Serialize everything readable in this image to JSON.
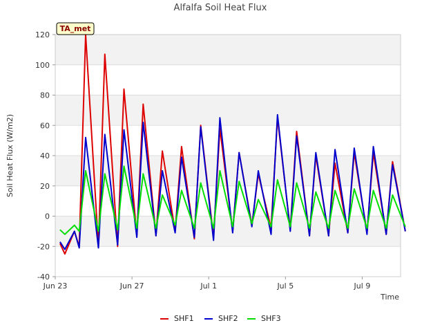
{
  "chart_data": {
    "type": "line",
    "title": "Alfalfa Soil Heat Flux",
    "xlabel": "Time",
    "ylabel": "Soil Heat Flux (W/m2)",
    "badge": "TA_met",
    "ylim": [
      -40,
      120
    ],
    "yticks": [
      -40,
      -20,
      0,
      20,
      40,
      60,
      80,
      100,
      120
    ],
    "xlim": [
      "2023-06-23",
      "2023-07-11"
    ],
    "xticks": [
      {
        "date": "2023-06-23",
        "label": "Jun 23"
      },
      {
        "date": "2023-06-27",
        "label": "Jun 27"
      },
      {
        "date": "2023-07-01",
        "label": "Jul 1"
      },
      {
        "date": "2023-07-05",
        "label": "Jul 5"
      },
      {
        "date": "2023-07-09",
        "label": "Jul 9"
      }
    ],
    "grid": "horizontal bands",
    "legend_position": "bottom-center",
    "series": [
      {
        "name": "SHF1",
        "color": "#dd0000",
        "x": [
          "2023-06-23T06:00",
          "2023-06-23T12:00",
          "2023-06-24T00:00",
          "2023-06-24T06:00",
          "2023-06-24T14:00",
          "2023-06-25T06:00",
          "2023-06-25T14:00",
          "2023-06-26T06:00",
          "2023-06-26T14:00",
          "2023-06-27T06:00",
          "2023-06-27T14:00",
          "2023-06-28T06:00",
          "2023-06-28T14:00",
          "2023-06-29T06:00",
          "2023-06-29T14:00",
          "2023-06-30T06:00",
          "2023-06-30T14:00",
          "2023-07-01T06:00",
          "2023-07-01T14:00",
          "2023-07-02T06:00",
          "2023-07-02T14:00",
          "2023-07-03T06:00",
          "2023-07-03T14:00",
          "2023-07-04T06:00",
          "2023-07-04T14:00",
          "2023-07-05T06:00",
          "2023-07-05T14:00",
          "2023-07-06T06:00",
          "2023-07-06T14:00",
          "2023-07-07T06:00",
          "2023-07-07T14:00",
          "2023-07-08T06:00",
          "2023-07-08T14:00",
          "2023-07-09T06:00",
          "2023-07-09T14:00",
          "2023-07-10T06:00",
          "2023-07-10T14:00",
          "2023-07-11T06:00"
        ],
        "y": [
          -18,
          -25,
          -10,
          -20,
          120,
          -20,
          107,
          -20,
          84,
          -13,
          74,
          -13,
          43,
          -10,
          46,
          -15,
          60,
          -14,
          58,
          -10,
          42,
          -6,
          28,
          -8,
          65,
          -9,
          56,
          -13,
          40,
          -13,
          35,
          -11,
          42,
          -11,
          42,
          -12,
          36,
          -10
        ]
      },
      {
        "name": "SHF2",
        "color": "#0000cc",
        "x": [
          "2023-06-23T06:00",
          "2023-06-23T12:00",
          "2023-06-24T00:00",
          "2023-06-24T06:00",
          "2023-06-24T14:00",
          "2023-06-25T06:00",
          "2023-06-25T14:00",
          "2023-06-26T06:00",
          "2023-06-26T14:00",
          "2023-06-27T06:00",
          "2023-06-27T14:00",
          "2023-06-28T06:00",
          "2023-06-28T14:00",
          "2023-06-29T06:00",
          "2023-06-29T14:00",
          "2023-06-30T06:00",
          "2023-06-30T14:00",
          "2023-07-01T06:00",
          "2023-07-01T14:00",
          "2023-07-02T06:00",
          "2023-07-02T14:00",
          "2023-07-03T06:00",
          "2023-07-03T14:00",
          "2023-07-04T06:00",
          "2023-07-04T14:00",
          "2023-07-05T06:00",
          "2023-07-05T14:00",
          "2023-07-06T06:00",
          "2023-07-06T14:00",
          "2023-07-07T06:00",
          "2023-07-07T14:00",
          "2023-07-08T06:00",
          "2023-07-08T14:00",
          "2023-07-09T06:00",
          "2023-07-09T14:00",
          "2023-07-10T06:00",
          "2023-07-10T14:00",
          "2023-07-11T06:00"
        ],
        "y": [
          -17,
          -22,
          -10,
          -21,
          52,
          -21,
          54,
          -19,
          57,
          -14,
          62,
          -13,
          30,
          -11,
          39,
          -14,
          59,
          -16,
          65,
          -11,
          42,
          -7,
          30,
          -12,
          67,
          -10,
          53,
          -13,
          42,
          -13,
          44,
          -11,
          45,
          -12,
          46,
          -12,
          34,
          -10
        ]
      },
      {
        "name": "SHF3",
        "color": "#00dd00",
        "x": [
          "2023-06-23T06:00",
          "2023-06-23T12:00",
          "2023-06-24T00:00",
          "2023-06-24T06:00",
          "2023-06-24T14:00",
          "2023-06-25T06:00",
          "2023-06-25T14:00",
          "2023-06-26T06:00",
          "2023-06-26T14:00",
          "2023-06-27T06:00",
          "2023-06-27T14:00",
          "2023-06-28T06:00",
          "2023-06-28T14:00",
          "2023-06-29T06:00",
          "2023-06-29T14:00",
          "2023-06-30T06:00",
          "2023-06-30T14:00",
          "2023-07-01T06:00",
          "2023-07-01T14:00",
          "2023-07-02T06:00",
          "2023-07-02T14:00",
          "2023-07-03T06:00",
          "2023-07-03T14:00",
          "2023-07-04T06:00",
          "2023-07-04T14:00",
          "2023-07-05T06:00",
          "2023-07-05T14:00",
          "2023-07-06T06:00",
          "2023-07-06T14:00",
          "2023-07-07T06:00",
          "2023-07-07T14:00",
          "2023-07-08T06:00",
          "2023-07-08T14:00",
          "2023-07-09T06:00",
          "2023-07-09T14:00",
          "2023-07-10T06:00",
          "2023-07-10T14:00",
          "2023-07-11T06:00"
        ],
        "y": [
          -9,
          -12,
          -6,
          -10,
          30,
          -10,
          28,
          -9,
          33,
          -8,
          28,
          -8,
          14,
          -6,
          17,
          -8,
          22,
          -8,
          30,
          -7,
          23,
          -5,
          11,
          -7,
          24,
          -7,
          22,
          -8,
          16,
          -8,
          17,
          -8,
          18,
          -8,
          17,
          -8,
          14,
          -7
        ]
      }
    ]
  }
}
